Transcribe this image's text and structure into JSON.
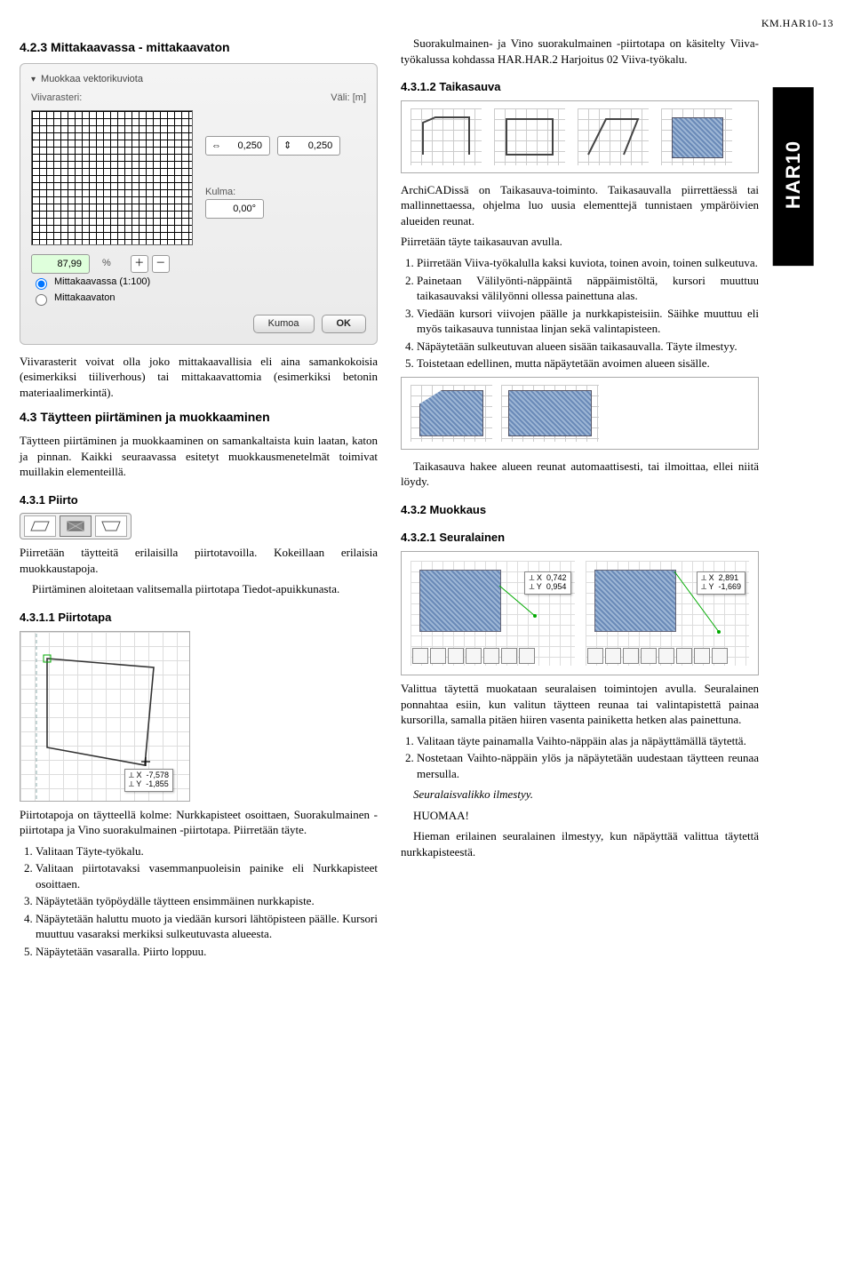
{
  "doc_code": "KM.HAR10-13",
  "side_tab": "HAR10",
  "s423_title": "4.2.3    Mittakaavassa - mittakaavaton",
  "panel": {
    "header_label": "Muokkaa vektorikuviota",
    "viivarasteri_label": "Viivarasteri:",
    "vali_label": "Väli: [m]",
    "h_value": "0,250",
    "v_value": "0,250",
    "kulma_label": "Kulma:",
    "kulma_value": "0,00°",
    "percent_value": "87,99",
    "percent_unit": "%",
    "radio1": "Mittakaavassa (1:100)",
    "radio2": "Mittakaavaton",
    "btn_cancel": "Kumoa",
    "btn_ok": "OK"
  },
  "s423_body": "Viivarasterit voivat olla joko mittakaavallisia eli aina samankokoisia (esimerkiksi tiiliverhous) tai mittakaavattomia (esimerkiksi betonin materiaalimerkintä).",
  "s43_title": "4.3    Täytteen piirtäminen ja muokkaaminen",
  "s43_body": "Täytteen piirtäminen ja muokkaaminen on samankaltaista kuin laatan, katon ja pinnan. Kaikki seuraavassa esitetyt muokkausmenetelmät toimivat muillakin elementeillä.",
  "s431_title": "4.3.1    Piirto",
  "s431_p1": "Piirretään täytteitä erilaisilla piirtotavoilla. Kokeillaan erilaisia muokkaustapoja.",
  "s431_p2": "Piirtäminen aloitetaan valitsemalla piirtotapa Tiedot-apuikkunasta.",
  "s4311_title": "4.3.1.1 Piirtotapa",
  "piirto_coord_x_label": "X",
  "piirto_coord_y_label": "Y",
  "piirto_coord_x": "-7,578",
  "piirto_coord_y": "-1,855",
  "s4311_p1": "Piirtotapoja on täytteellä kolme: Nurkkapisteet osoittaen, Suorakulmainen -piirtotapa ja Vino suorakulmainen -piirtotapa. Piirretään täyte.",
  "s4311_list": [
    "Valitaan Täyte-työkalu.",
    "Valitaan piirtotavaksi vasemmanpuoleisin painike eli Nurkkapisteet osoittaen.",
    "Näpäytetään työpöydälle täytteen ensimmäinen nurkkapiste.",
    "Näpäytetään haluttu muoto ja viedään kursori lähtöpisteen päälle.   Kursori muuttuu vasaraksi merkiksi sulkeutuvasta alueesta.",
    "Näpäytetään vasaralla. Piirto loppuu."
  ],
  "right_intro": "Suorakulmainen- ja Vino suorakulmainen -piirtotapa on käsitelty Viiva-työkalussa kohdassa HAR.HAR.2 Harjoitus 02 Viiva-työkalu.",
  "s4312_title": "4.3.1.2 Taikasauva",
  "s4312_p1": "ArchiCADissä on Taikasauva-toiminto. Taikasauvalla piirrettäessä tai mallinnettaessa, ohjelma luo uusia elementtejä tunnistaen ympäröivien alueiden reunat.",
  "s4312_p2": "Piirretään täyte taikasauvan avulla.",
  "s4312_list": [
    "Piirretään Viiva-työkalulla kaksi kuviota, toinen avoin, toinen sulkeutuva.",
    "Painetaan Välilyönti-näppäintä näppäimistöltä, kursori muuttuu taikasauvaksi välilyönni ollessa painettuna alas.",
    "Viedään kursori viivojen päälle ja nurkkapisteisiin. Säihke muuttuu eli myös taikasauva tunnistaa linjan sekä valintapisteen.",
    "Näpäytetään sulkeutuvan alueen sisään taikasauvalla. Täyte ilmestyy.",
    "Toistetaan edellinen, mutta näpäytetään avoimen alueen sisälle."
  ],
  "s4312_p3": "Taikasauva hakee alueen reunat automaattisesti, tai ilmoittaa, ellei niitä löydy.",
  "s432_title": "4.3.2    Muokkaus",
  "s4321_title": "4.3.2.1 Seuralainen",
  "seur_coords": {
    "a_x": "0,742",
    "a_y": "0,954",
    "b_x": "2,891",
    "b_y": "-1,669"
  },
  "s4321_p1": "Valittua täytettä muokataan seuralaisen toimintojen avulla. Seuralainen ponnahtaa esiin, kun valitun täytteen reunaa tai valintapistettä painaa kursorilla, samalla pitäen hiiren vasenta painiketta hetken alas painettuna.",
  "s4321_list": [
    "Valitaan täyte painamalla Vaihto-näppäin alas ja näpäyttämällä täytettä.",
    "Nostetaan Vaihto-näppäin ylös ja näpäytetään uudestaan täytteen reunaa mersulla."
  ],
  "s4321_p2": "Seuralaisvalikko ilmestyy.",
  "s4321_p3": "HUOMAA!",
  "s4321_p4": "Hieman erilainen seuralainen ilmestyy, kun näpäyttää valittua täytettä nurkkapisteestä."
}
